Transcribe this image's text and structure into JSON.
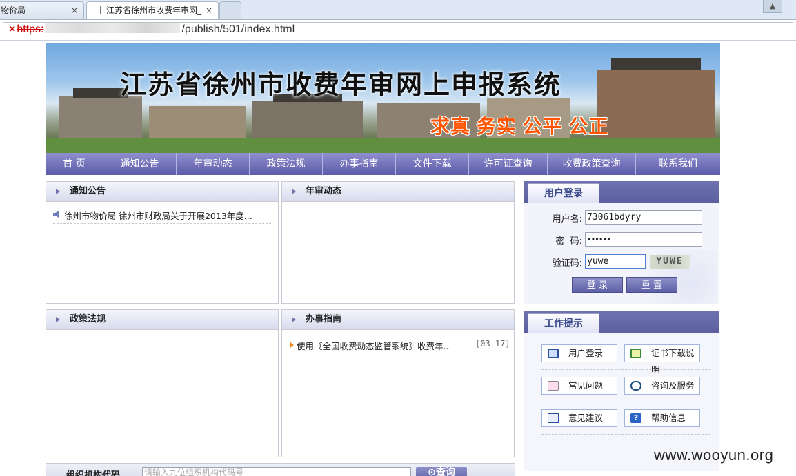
{
  "browser": {
    "tabs": [
      {
        "label": "物价局",
        "close": "×"
      },
      {
        "label": "江苏省徐州市收费年审网_",
        "close": "×"
      },
      {
        "label": ""
      }
    ],
    "user_button": "▲",
    "address": {
      "lock": "×",
      "scheme": "https:",
      "rest": "/publish/501/index.html"
    }
  },
  "banner": {
    "title": "江苏省徐州市收费年审网上申报系统",
    "slogan": "求真 务实 公平 公正"
  },
  "nav": [
    "首 页",
    "通知公告",
    "年审动态",
    "政策法规",
    "办事指南",
    "文件下载",
    "许可证查询",
    "收费政策查询",
    "联系我们"
  ],
  "panels": {
    "notice": {
      "title": "通知公告",
      "items": [
        {
          "text": "徐州市物价局 徐州市财政局关于开展2013年度..."
        }
      ]
    },
    "annual": {
      "title": "年审动态"
    },
    "policy": {
      "title": "政策法规"
    },
    "guide": {
      "title": "办事指南",
      "items": [
        {
          "text": "使用《全国收费动态监管系统》收费年...",
          "date": "[03-17]"
        }
      ]
    }
  },
  "login": {
    "title": "用户登录",
    "username_label": "用户名:",
    "username_value": "73061bdyry",
    "password_label": "密  码:",
    "password_value": "••••••",
    "captcha_label": "验证码:",
    "captcha_value": "yuwe",
    "captcha_image_text": "YUWE",
    "login_button": "登 录",
    "reset_button": "重 置"
  },
  "tips": {
    "title": "工作提示",
    "buttons": [
      "用户登录",
      "证书下载说明",
      "常见问题",
      "咨询及服务",
      "意见建议",
      "帮助信息"
    ]
  },
  "bottom": {
    "label": "组织机构代码",
    "placeholder": "请输入九位组织机构代码号",
    "query_button": "查询"
  },
  "watermark": "www.wooyun.org",
  "colors": {
    "nav": "#6e6db8",
    "slogan": "#ff5400",
    "accent": "#5b5f9f"
  }
}
